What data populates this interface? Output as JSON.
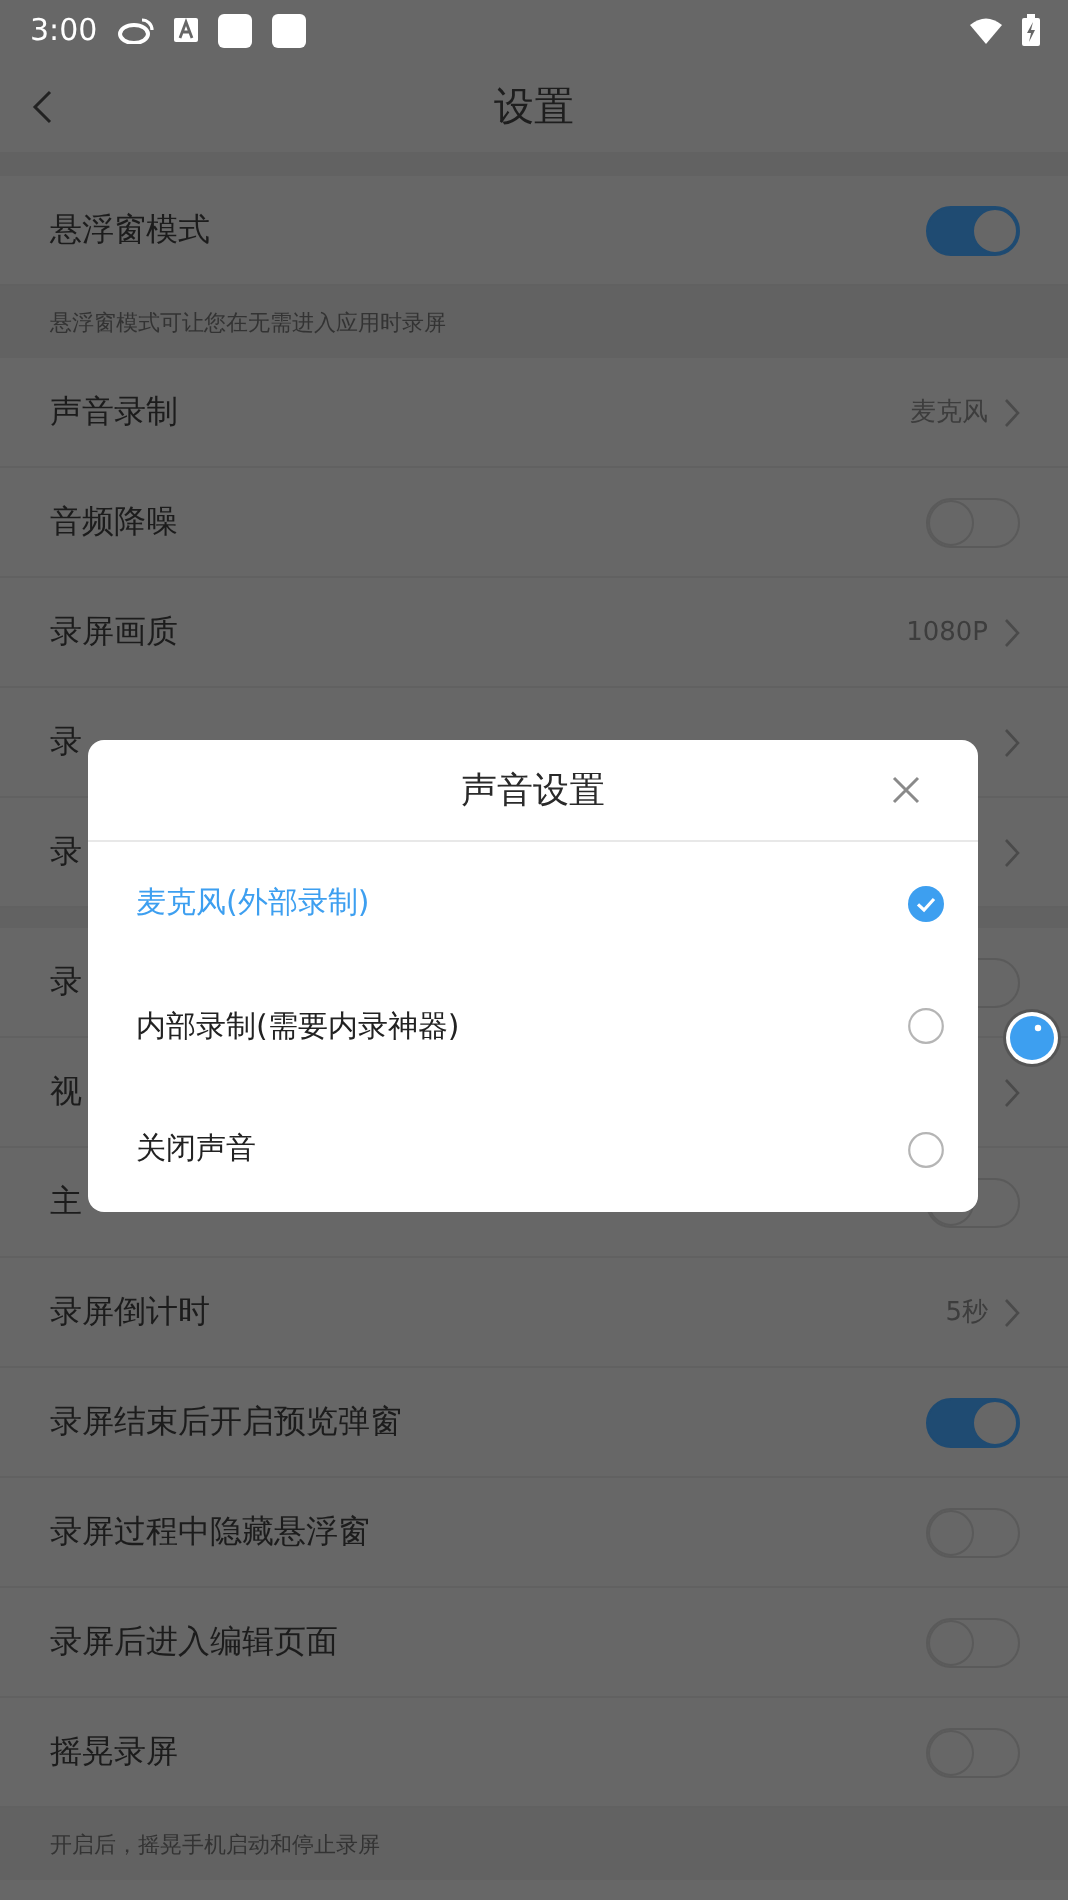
{
  "status_bar": {
    "time": "3:00"
  },
  "header": {
    "title": "设置"
  },
  "items": [
    {
      "kind": "switch",
      "label": "悬浮窗模式",
      "on": true
    },
    {
      "kind": "note",
      "text": "悬浮窗模式可让您在无需进入应用时录屏"
    },
    {
      "kind": "link",
      "label": "声音录制",
      "value": "麦克风"
    },
    {
      "kind": "switch",
      "label": "音频降噪",
      "on": false
    },
    {
      "kind": "link",
      "label": "录屏画质",
      "value": "1080P"
    },
    {
      "kind": "link",
      "label": "录"
    },
    {
      "kind": "link",
      "label": "录"
    },
    {
      "kind": "gap"
    },
    {
      "kind": "switch",
      "label": "录",
      "on": false
    },
    {
      "kind": "link",
      "label": "视"
    },
    {
      "kind": "switch",
      "label": "主",
      "on": false
    },
    {
      "kind": "link",
      "label": "录屏倒计时",
      "value": "5秒"
    },
    {
      "kind": "switch",
      "label": "录屏结束后开启预览弹窗",
      "on": true
    },
    {
      "kind": "switch",
      "label": "录屏过程中隐藏悬浮窗",
      "on": false
    },
    {
      "kind": "switch",
      "label": "录屏后进入编辑页面",
      "on": false
    },
    {
      "kind": "switch",
      "label": "摇晃录屏",
      "on": false
    },
    {
      "kind": "note",
      "text": "开启后，摇晃手机启动和停止录屏"
    }
  ],
  "dialog": {
    "title": "声音设置",
    "options": [
      {
        "label": "麦克风(外部录制)",
        "selected": true
      },
      {
        "label": "内部录制(需要内录神器)",
        "selected": false
      },
      {
        "label": "关闭声音",
        "selected": false
      }
    ]
  }
}
